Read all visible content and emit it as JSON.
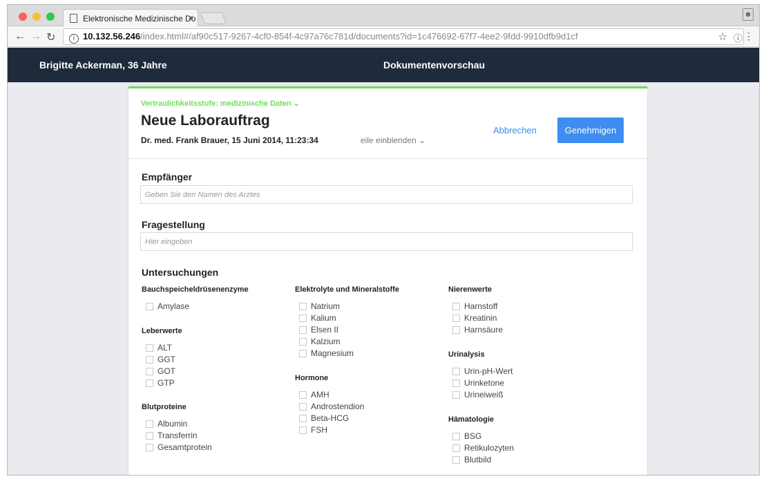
{
  "browser": {
    "tab_title": "Elektronische Medizinische Do",
    "tab_close": "×",
    "url_host": "10.132.56.246",
    "url_path": "/index.html#/af90c517-9267-4cf0-854f-4c97a76c781d/documents?id=1c476692-67f7-4ee2-9fdd-9910dfb9d1cf",
    "colors": {
      "close": "#fc605c",
      "minimize": "#fdbc40",
      "zoom": "#34c84a"
    }
  },
  "header": {
    "patient": "Brigitte Ackerman, 36 Jahre",
    "title": "Dokumentenvorschau",
    "bg_color": "#1f2a3c"
  },
  "document": {
    "confidentiality": "Vertraulichkeitsstufe: medizinische Daten ⌄",
    "title": "Neue Laborauftrag",
    "author_line": "Dr. med. Frank Brauer, 15 Juni 2014, 11:23:34",
    "show_lines": "eile einblenden ⌄",
    "cancel_label": "Abbrechen",
    "approve_label": "Genehmigen",
    "accent_color": "#6fdc5c"
  },
  "form": {
    "recipient_label": "Empfänger",
    "recipient_placeholder": "Geben Sie den Namen des Arztes",
    "question_label": "Fragestellung",
    "question_placeholder": "Hier eingeben",
    "investigations_label": "Untersuchungen"
  },
  "groups": [
    {
      "title": "Bauchspeicheldrüsenenzyme",
      "items": [
        "Amylase"
      ]
    },
    {
      "title": "Leberwerte",
      "items": [
        "ALT",
        "GGT",
        "GOT",
        "GTP"
      ]
    },
    {
      "title": "Blutproteine",
      "items": [
        "Albumin",
        "Transferrin",
        "Gesamtprotein"
      ]
    },
    {
      "title": "Elektrolyte und Mineralstoffe",
      "items": [
        "Natrium",
        "Kalium",
        "Elsen II",
        "Kalzium",
        "Magnesium"
      ]
    },
    {
      "title": "Hormone",
      "items": [
        "AMH",
        "Androstendion",
        "Beta-HCG",
        "FSH"
      ]
    },
    {
      "title": "Nierenwerte",
      "items": [
        "Harnstoff",
        "Kreatinin",
        "Harnsäure"
      ]
    },
    {
      "title": "Urinalysis",
      "items": [
        "Urin-pH-Wert",
        "Urinketone",
        "Urineiweiß"
      ]
    },
    {
      "title": "Hämatologie",
      "items": [
        "BSG",
        "Retikulozyten",
        "Blutbild"
      ]
    }
  ]
}
